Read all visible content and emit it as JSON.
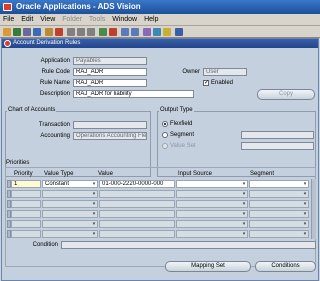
{
  "app_title": "Oracle Applications - ADS Vision",
  "menu": [
    "File",
    "Edit",
    "View",
    "Folder",
    "Tools",
    "Window",
    "Help"
  ],
  "menu_disabled": [
    false,
    false,
    false,
    true,
    true,
    false,
    false
  ],
  "window_title": "Account Derivation Rules",
  "header": {
    "application_label": "Application",
    "application_value": "Payables",
    "rule_code_label": "Rule Code",
    "rule_code_value": "RAJ_ADR",
    "rule_name_label": "Rule Name",
    "rule_name_value": "RAJ_ADR",
    "description_label": "Description",
    "description_value": "RAJ_ADR for liability",
    "owner_label": "Owner",
    "owner_value": "User",
    "enabled_label": "Enabled",
    "enabled_checked": true,
    "copy_button": "Copy"
  },
  "chart_of_accounts": {
    "title": "Chart of Accounts",
    "transaction_label": "Transaction",
    "transaction_value": "",
    "accounting_label": "Accounting",
    "accounting_value": "Operations Accounting Flex"
  },
  "output_type": {
    "title": "Output Type",
    "options": [
      {
        "label": "Flexfield",
        "selected": true,
        "disabled": false
      },
      {
        "label": "Segment",
        "selected": false,
        "disabled": false
      },
      {
        "label": "Value Set",
        "selected": false,
        "disabled": true
      }
    ]
  },
  "priorities": {
    "title": "Priorities",
    "columns": [
      "Priority",
      "Value Type",
      "Value",
      "Input Source",
      "Segment"
    ],
    "rows": [
      {
        "priority": "1",
        "value_type": "Constant",
        "value": "01-000-2220-0000-000",
        "input_source": "",
        "segment": ""
      },
      {
        "priority": "",
        "value_type": "",
        "value": "",
        "input_source": "",
        "segment": ""
      },
      {
        "priority": "",
        "value_type": "",
        "value": "",
        "input_source": "",
        "segment": ""
      },
      {
        "priority": "",
        "value_type": "",
        "value": "",
        "input_source": "",
        "segment": ""
      },
      {
        "priority": "",
        "value_type": "",
        "value": "",
        "input_source": "",
        "segment": ""
      },
      {
        "priority": "",
        "value_type": "",
        "value": "",
        "input_source": "",
        "segment": ""
      }
    ]
  },
  "condition": {
    "label": "Condition",
    "value": ""
  },
  "buttons": {
    "mapping_set": "Mapping Set",
    "conditions": "Conditions"
  },
  "colors": {
    "title_bar": "#1c4f9a",
    "window_bg": "#c4d0dd",
    "current_cell": "#fffbd0"
  }
}
